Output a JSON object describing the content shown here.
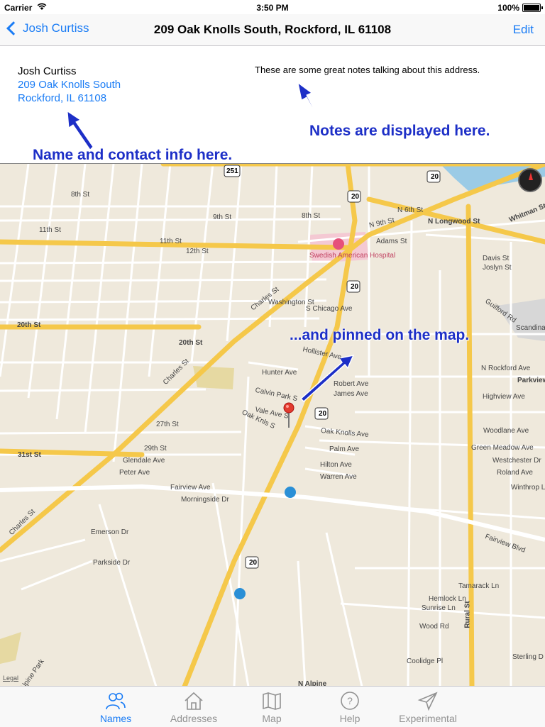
{
  "status_bar": {
    "carrier": "Carrier",
    "time": "3:50 PM",
    "battery": "100%"
  },
  "nav": {
    "back_label": "Josh Curtiss",
    "title": "209 Oak Knolls South, Rockford, IL 61108",
    "edit_label": "Edit"
  },
  "contact": {
    "name": "Josh Curtiss",
    "address_line1": "209 Oak Knolls South",
    "address_line2": "Rockford, IL 61108"
  },
  "notes": "These are some great notes talking about this address.",
  "annotations": {
    "notes": "Notes are displayed here.",
    "name": "Name and contact info here.",
    "pin": "...and pinned on the map."
  },
  "map": {
    "legal": "Legal",
    "labels": {
      "swedish_hospital": "Swedish American Hospital",
      "charles_st": "Charles St",
      "eleventh_st": "11th St",
      "twelfth_st": "12th St",
      "eighth_st": "8th St",
      "ninth_st": "9th St",
      "n_9th_st": "N 9th St",
      "n_6th_st": "N 6th St",
      "n_longwood": "N Longwood St",
      "adams_st": "Adams St",
      "washington_st": "Washington St",
      "s_chicago_ave": "S Chicago Ave",
      "hunter_ave": "Hunter Ave",
      "robert_ave": "Robert Ave",
      "james_ave": "James Ave",
      "calvin_park": "Calvin Park S",
      "vale_ave": "Vale Ave S",
      "oak_knls": "Oak Knls S",
      "oak_knolls_ave": "Oak Knolls Ave",
      "palm_ave": "Palm Ave",
      "hilton_ave": "Hilton Ave",
      "warren_ave": "Warren Ave",
      "fairview_ave": "Fairview Ave",
      "fairview_blvd": "Fairview Blvd",
      "peter_ave": "Peter Ave",
      "glendale_ave": "Glendale Ave",
      "morningside": "Morningside Dr",
      "emerson_dr": "Emerson Dr",
      "parkside_dr": "Parkside Dr",
      "twentieth_st": "20th St",
      "thirtyfirst_st": "31st St",
      "twentyseventh_st": "27th St",
      "twentyninth_st": "29th St",
      "highview": "Highview Ave",
      "woodlane": "Woodlane Ave",
      "green_meadow": "Green Meadow Ave",
      "westchester": "Westchester Dr",
      "roland_ave": "Roland Ave",
      "winthrop": "Winthrop Ln",
      "n_rockford_ave": "N Rockford Ave",
      "parkview": "Parkview",
      "guilford": "Guilford Rd",
      "davis_st": "Davis St",
      "joslyn_st": "Joslyn St",
      "whitman_st": "Whitman St",
      "hemlock": "Hemlock Ln",
      "sunrise": "Sunrise Ln",
      "woodrd": "Wood Rd",
      "coolidge": "Coolidge Pl",
      "sterling": "Sterling D",
      "tamarack": "Tamarack Ln",
      "rural_st": "Rural St",
      "alpine_park": "Alpine Park",
      "hollister": "Hollister Ave",
      "route20": "20",
      "route251": "251",
      "scandina": "Scandina Cemet",
      "n_alpine": "N Alpine"
    },
    "colors": {
      "road_major": "#f5c84a",
      "road_minor": "#ffffff",
      "land": "#efe9dc",
      "park": "#e6d9a2",
      "water": "#9bcbe6",
      "pin": "#e23b2e"
    }
  },
  "tabs": [
    {
      "label": "Names",
      "icon": "people-icon",
      "active": true
    },
    {
      "label": "Addresses",
      "icon": "house-icon",
      "active": false
    },
    {
      "label": "Map",
      "icon": "map-icon",
      "active": false
    },
    {
      "label": "Help",
      "icon": "question-icon",
      "active": false
    },
    {
      "label": "Experimental",
      "icon": "paper-plane-icon",
      "active": false
    }
  ]
}
